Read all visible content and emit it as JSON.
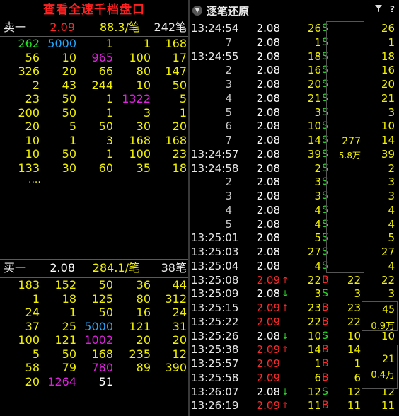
{
  "left": {
    "title": "查看全速千档盘口",
    "sell": {
      "label": "卖一",
      "price": "2.09",
      "avg": "88.3/笔",
      "vol": "242笔"
    },
    "sell_grid": [
      [
        "262",
        "5000",
        "1",
        "1",
        "168"
      ],
      [
        "56",
        "10",
        "965",
        "100",
        "17"
      ],
      [
        "326",
        "20",
        "66",
        "80",
        "147"
      ],
      [
        "2",
        "43",
        "244",
        "10",
        "50"
      ],
      [
        "23",
        "50",
        "1",
        "1322",
        "5"
      ],
      [
        "200",
        "50",
        "1",
        "3",
        "1"
      ],
      [
        "20",
        "5",
        "50",
        "30",
        "20"
      ],
      [
        "10",
        "1",
        "3",
        "168",
        "168"
      ],
      [
        "10",
        "50",
        "1",
        "100",
        "23"
      ],
      [
        "133",
        "30",
        "60",
        "35",
        "18"
      ]
    ],
    "dots": "....",
    "buy": {
      "label": "买一",
      "price": "2.08",
      "avg": "284.1/笔",
      "vol": "38笔"
    },
    "buy_grid": [
      [
        "183",
        "152",
        "50",
        "36",
        "44"
      ],
      [
        "1",
        "18",
        "125",
        "80",
        "312"
      ],
      [
        "24",
        "1",
        "50",
        "16",
        "24"
      ],
      [
        "37",
        "25",
        "5000",
        "121",
        "31"
      ],
      [
        "100",
        "121",
        "1002",
        "20",
        "20"
      ],
      [
        "5",
        "50",
        "168",
        "235",
        "12"
      ],
      [
        "58",
        "79",
        "780",
        "89",
        "390"
      ],
      [
        "20",
        "1264",
        "51",
        "",
        ""
      ]
    ],
    "colors": {
      "yellow": "#f0f000",
      "green": "#20e020",
      "cyan": "#20a8ff",
      "magenta": "#e020e0",
      "red": "#ff2020"
    }
  },
  "right": {
    "title": "逐笔还原",
    "collapse_icon": "chevron-down-icon",
    "filter_icon": "filter-icon",
    "help_label": "?",
    "trades": [
      {
        "time": "13:24:54",
        "price": "2.08",
        "vol": "26",
        "side": "S",
        "g2": "26"
      },
      {
        "time": "7",
        "price": "2.08",
        "vol": "1",
        "side": "S",
        "g2": "1"
      },
      {
        "time": "13:24:55",
        "price": "2.08",
        "vol": "18",
        "side": "S",
        "g2": "18"
      },
      {
        "time": "2",
        "price": "2.08",
        "vol": "16",
        "side": "S",
        "g2": "16"
      },
      {
        "time": "3",
        "price": "2.08",
        "vol": "20",
        "side": "S",
        "g2": "20"
      },
      {
        "time": "4",
        "price": "2.08",
        "vol": "21",
        "side": "S",
        "g2": "21"
      },
      {
        "time": "5",
        "price": "2.08",
        "vol": "3",
        "side": "S",
        "g2": "3"
      },
      {
        "time": "6",
        "price": "2.08",
        "vol": "10",
        "side": "S",
        "g2": "10"
      },
      {
        "time": "7",
        "price": "2.08",
        "vol": "14",
        "side": "S",
        "g2": "14"
      },
      {
        "time": "13:24:57",
        "price": "2.08",
        "vol": "39",
        "side": "S",
        "g2": "39"
      },
      {
        "time": "13:24:58",
        "price": "2.08",
        "vol": "2",
        "side": "S",
        "g2": "2"
      },
      {
        "time": "2",
        "price": "2.08",
        "vol": "3",
        "side": "S",
        "g2": "3"
      },
      {
        "time": "3",
        "price": "2.08",
        "vol": "3",
        "side": "S",
        "g2": "3"
      },
      {
        "time": "4",
        "price": "2.08",
        "vol": "4",
        "side": "S",
        "g2": "4"
      },
      {
        "time": "5",
        "price": "2.08",
        "vol": "4",
        "side": "S",
        "g2": "4"
      },
      {
        "time": "13:25:01",
        "price": "2.08",
        "vol": "5",
        "side": "S",
        "g2": "5"
      },
      {
        "time": "13:25:03",
        "price": "2.08",
        "vol": "27",
        "side": "S",
        "g2": "27"
      },
      {
        "time": "13:25:04",
        "price": "2.08",
        "vol": "4",
        "side": "S",
        "g2": "4"
      },
      {
        "time": "13:25:08",
        "price": "2.09",
        "arrow": "↑",
        "vol": "22",
        "side": "B",
        "g1": "22",
        "g2": "22"
      },
      {
        "time": "13:25:09",
        "price": "2.08",
        "arrow": "↓",
        "vol": "3",
        "side": "S",
        "g1": "3",
        "g2": "3"
      },
      {
        "time": "13:25:15",
        "price": "2.09",
        "arrow": "↑",
        "vol": "23",
        "side": "B",
        "g1": "23"
      },
      {
        "time": "13:25:22",
        "price": "2.09",
        "vol": "22",
        "side": "B",
        "g1": "22"
      },
      {
        "time": "13:25:26",
        "price": "2.08",
        "arrow": "↓",
        "vol": "10",
        "side": "S",
        "g1": "10",
        "g2": "10"
      },
      {
        "time": "13:25:38",
        "price": "2.09",
        "arrow": "↑",
        "vol": "14",
        "side": "B",
        "g1": "14"
      },
      {
        "time": "13:25:57",
        "price": "2.09",
        "vol": "1",
        "side": "B",
        "g1": "1"
      },
      {
        "time": "13:25:58",
        "price": "2.09",
        "vol": "6",
        "side": "B",
        "g1": "6"
      },
      {
        "time": "13:26:07",
        "price": "2.08",
        "arrow": "↓",
        "vol": "12",
        "side": "S",
        "g1": "12",
        "g2": "12"
      },
      {
        "time": "13:26:19",
        "price": "2.09",
        "arrow": "↑",
        "vol": "11",
        "side": "B",
        "g1": "11",
        "g2": "11"
      }
    ],
    "groups": {
      "big_total": "277",
      "big_amount": "5.8万",
      "g_a_total": "45",
      "g_a_amount": "0.9万",
      "g_b_total": "21",
      "g_b_amount": "0.4万"
    }
  }
}
